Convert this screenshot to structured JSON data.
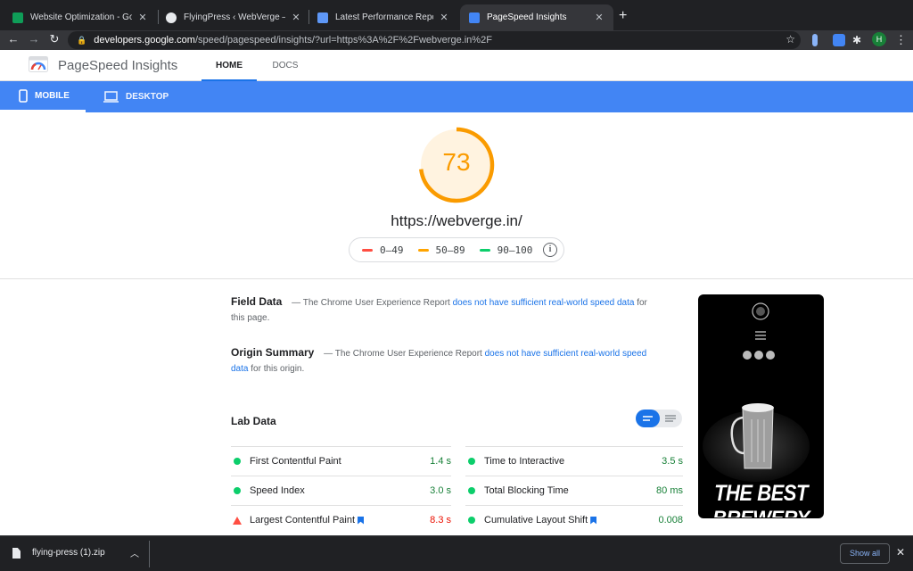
{
  "browser": {
    "tabs": [
      {
        "title": "Website Optimization - Google",
        "favicon_color": "#0f9d58"
      },
      {
        "title": "FlyingPress ‹ WebVerge — Wo",
        "favicon_color": "#e8eaed"
      },
      {
        "title": "Latest Performance Report fo",
        "favicon_color": "#5e97f6"
      },
      {
        "title": "PageSpeed Insights",
        "favicon_color": "#4285f4"
      }
    ],
    "close_glyph": "✕",
    "new_tab_glyph": "+",
    "url_host": "developers.google.com",
    "url_path": "/speed/pagespeed/insights/?url=https%3A%2F%2Fwebverge.in%2F",
    "profile_initial": "H"
  },
  "psi": {
    "brand": "PageSpeed Insights",
    "nav": {
      "home": "HOME",
      "docs": "DOCS"
    },
    "devices": {
      "mobile": "MOBILE",
      "desktop": "DESKTOP"
    },
    "score": 73,
    "score_fraction": 0.73,
    "score_color": "#fa9b00",
    "url": "https://webverge.in/",
    "legend": [
      {
        "range": "0–49",
        "color": "#ff4e42"
      },
      {
        "range": "50–89",
        "color": "#ffa400"
      },
      {
        "range": "90–100",
        "color": "#0cce6b"
      }
    ],
    "info_glyph": "i",
    "field": {
      "title": "Field Data",
      "prefix": "— The Chrome User Experience Report",
      "link": "does not have sufficient real-world speed data",
      "suffix": "for this page."
    },
    "origin": {
      "title": "Origin Summary",
      "prefix": "— The Chrome User Experience Report",
      "link": "does not have sufficient real-world speed data",
      "suffix": "for this origin."
    },
    "lab_title": "Lab Data",
    "metrics_left": [
      {
        "name": "First Contentful Paint",
        "value": "1.4 s",
        "status": "good",
        "flag": false
      },
      {
        "name": "Speed Index",
        "value": "3.0 s",
        "status": "good",
        "flag": false
      },
      {
        "name": "Largest Contentful Paint",
        "value": "8.3 s",
        "status": "bad",
        "flag": true
      }
    ],
    "metrics_right": [
      {
        "name": "Time to Interactive",
        "value": "3.5 s",
        "status": "good",
        "flag": false
      },
      {
        "name": "Total Blocking Time",
        "value": "80 ms",
        "status": "good",
        "flag": false
      },
      {
        "name": "Cumulative Layout Shift",
        "value": "0.008",
        "status": "good",
        "flag": true
      }
    ],
    "preview": {
      "line1": "THE BEST",
      "line2": "BREWERY"
    }
  },
  "downloads": {
    "file": "flying-press (1).zip",
    "show_all": "Show all"
  }
}
